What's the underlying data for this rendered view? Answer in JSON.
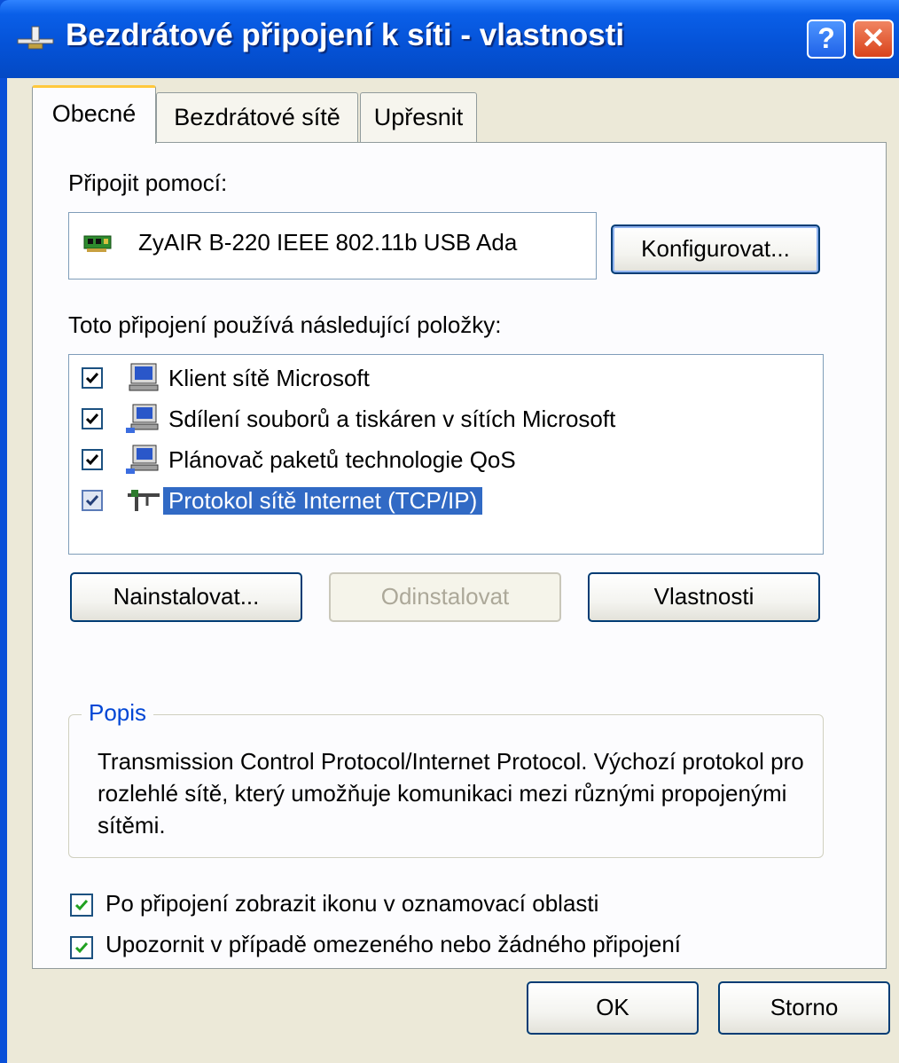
{
  "window": {
    "title": "Bezdrátové připojení k síti - vlastnosti",
    "help_label": "?",
    "close_label": "✕"
  },
  "tabs": [
    {
      "label": "Obecné",
      "active": true
    },
    {
      "label": "Bezdrátové sítě",
      "active": false
    },
    {
      "label": "Upřesnit",
      "active": false
    }
  ],
  "general": {
    "connect_using_label": "Připojit pomocí:",
    "adapter_name": "ZyAIR B-220 IEEE 802.11b USB Ada",
    "configure_button": "Konfigurovat...",
    "items_label": "Toto připojení používá následující položky:",
    "items": [
      {
        "label": "Klient sítě Microsoft",
        "checked": true,
        "icon": "network-client-icon"
      },
      {
        "label": "Sdílení souborů a tiskáren v sítích Microsoft",
        "checked": true,
        "icon": "network-service-icon"
      },
      {
        "label": "Plánovač paketů technologie QoS",
        "checked": true,
        "icon": "network-service-icon"
      },
      {
        "label": "Protokol sítě Internet (TCP/IP)",
        "checked": true,
        "icon": "protocol-icon",
        "selected": true
      }
    ],
    "install_button": "Nainstalovat...",
    "uninstall_button": "Odinstalovat",
    "properties_button": "Vlastnosti",
    "description_legend": "Popis",
    "description_text": "Transmission Control Protocol/Internet Protocol. Výchozí protokol pro rozlehlé sítě, který umožňuje komunikaci mezi různými propojenými sítěmi.",
    "show_icon_label": "Po připojení zobrazit ikonu v oznamovací oblasti",
    "show_icon_checked": true,
    "notify_label": "Upozornit v případě omezeného nebo žádného připojení",
    "notify_checked": true
  },
  "footer": {
    "ok_button": "OK",
    "cancel_button": "Storno"
  },
  "colors": {
    "titlebar": "#0553d8",
    "selection": "#316ac5",
    "legend": "#0046d5",
    "dialog_bg": "#ece9d8"
  }
}
